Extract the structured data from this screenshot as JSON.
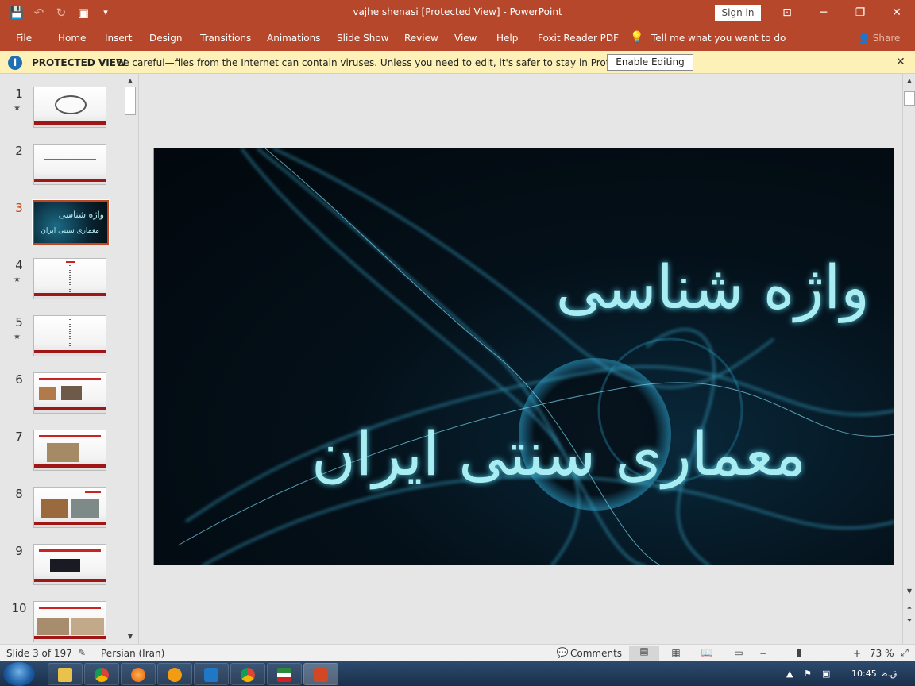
{
  "window": {
    "title": "vajhe shenasi [Protected View]  -  PowerPoint",
    "signin": "Sign in",
    "min": "─",
    "restore": "❐",
    "close": "✕",
    "ribbon_display": "⊡"
  },
  "qat": {
    "save": "💾",
    "undo": "↶",
    "redo": "↻",
    "present": "▣",
    "customize": "▾"
  },
  "ribbon": {
    "tabs": [
      "File",
      "Home",
      "Insert",
      "Design",
      "Transitions",
      "Animations",
      "Slide Show",
      "Review",
      "View",
      "Help",
      "Foxit Reader PDF"
    ],
    "tell_me": "Tell me what you want to do",
    "share": "Share"
  },
  "protected_view": {
    "title": "PROTECTED VIEW",
    "message": "Be careful—files from the Internet can contain viruses. Unless you need to edit, it's safer to stay in Protected View.",
    "button": "Enable Editing",
    "icon": "i"
  },
  "thumbnails": [
    {
      "num": "1",
      "star": true
    },
    {
      "num": "2",
      "star": false
    },
    {
      "num": "3",
      "star": false,
      "active": true
    },
    {
      "num": "4",
      "star": true
    },
    {
      "num": "5",
      "star": true
    },
    {
      "num": "6",
      "star": false
    },
    {
      "num": "7",
      "star": false
    },
    {
      "num": "8",
      "star": false
    },
    {
      "num": "9",
      "star": false
    },
    {
      "num": "10",
      "star": false
    }
  ],
  "thumb3": {
    "line1": "واژه شناسی",
    "line2": "معماری سنتی ایران"
  },
  "slide": {
    "title_line1": "واژه شناسی",
    "title_line2": "معماری سنتی ایران"
  },
  "status": {
    "slide_info": "Slide 3 of 197",
    "language": "Persian (Iran)",
    "comments": "Comments",
    "zoom": "73 %",
    "minus": "−",
    "plus": "+"
  },
  "taskbar": {
    "time": "10:45 ق.ظ"
  },
  "star_glyph": "★"
}
